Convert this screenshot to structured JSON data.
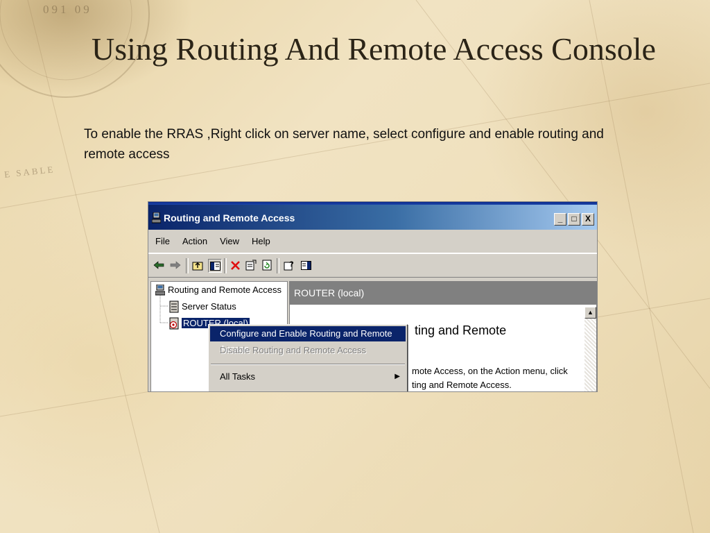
{
  "slide": {
    "title": "Using Routing And Remote Access Console",
    "body": "To enable the RRAS ,Right click on server name, select configure  and enable routing and remote access",
    "bg_compass_text": "091   09",
    "bg_map_text": "E SABLE"
  },
  "window": {
    "title": "Routing and Remote Access",
    "caption_minimize": "_",
    "caption_maximize": "□",
    "caption_close": "X",
    "menu": {
      "file": "File",
      "action": "Action",
      "view": "View",
      "help": "Help"
    },
    "toolbar_icons": [
      "back-arrow-icon",
      "forward-arrow-icon",
      "up-folder-icon",
      "show-hide-tree-icon",
      "delete-icon",
      "properties-icon",
      "refresh-icon",
      "help-icon",
      "console-icon"
    ],
    "tree": {
      "root": "Routing and Remote Access",
      "server_status": "Server Status",
      "router": "ROUTER (local)"
    },
    "right_pane": {
      "header": "ROUTER (local)",
      "heading_fragment": "ting and Remote",
      "line1": "mote Access, on the Action menu, click",
      "line2": "ting and Remote Access."
    },
    "context_menu": {
      "configure": "Configure and Enable Routing and Remote Access",
      "disable": "Disable Routing and Remote Access",
      "all_tasks": "All Tasks"
    }
  },
  "colors": {
    "selection": "#0a246a",
    "window_face": "#d4d0c8",
    "title_text": "#2b2417"
  }
}
